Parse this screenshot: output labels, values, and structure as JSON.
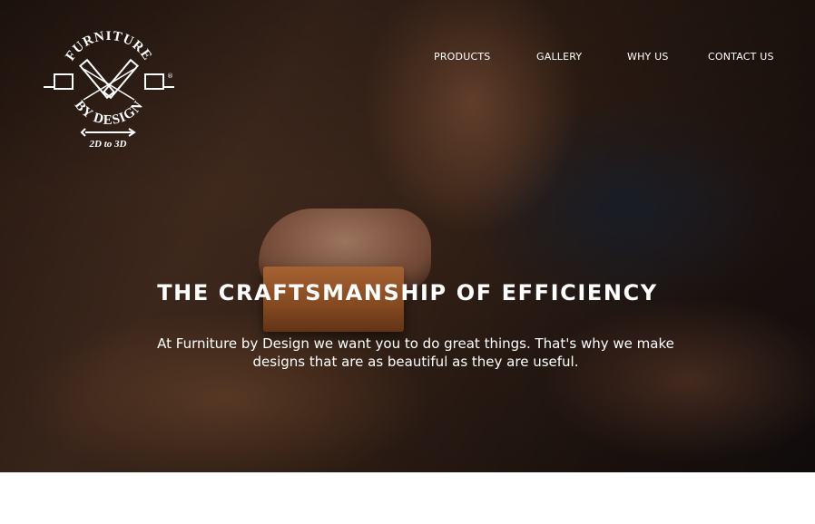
{
  "logo": {
    "top_text": "FURNITURE",
    "bottom_text": "BY DESIGN",
    "tagline": "2D to 3D",
    "registered_mark": "®",
    "icon": "crossed-pencils-logo"
  },
  "nav": {
    "items": [
      {
        "label": "PRODUCTS"
      },
      {
        "label": "GALLERY"
      },
      {
        "label": "WHY US"
      },
      {
        "label": "CONTACT US"
      }
    ]
  },
  "hero": {
    "headline": "THE CRAFTSMANSHIP OF EFFICIENCY",
    "subtext": "At Furniture by Design we want you to do great things. That's why we make designs that are as beautiful as they are useful.",
    "image": "craftsman-sanding-wood-photo"
  },
  "colors": {
    "text": "#ffffff",
    "page_background": "#ffffff"
  }
}
